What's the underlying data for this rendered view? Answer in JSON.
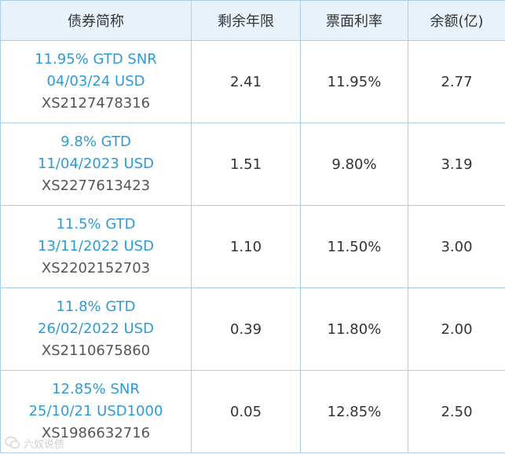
{
  "headers": [
    "债券简称",
    "剩余年限",
    "票面利率",
    "余额(亿)"
  ],
  "rows": [
    {
      "name_line1": "11.95% GTD SNR",
      "name_line2": "04/03/24 USD",
      "isin": "XS2127478316",
      "remaining_years": "2.41",
      "coupon_rate": "11.95%",
      "balance": "2.77"
    },
    {
      "name_line1": "9.8% GTD",
      "name_line2": "11/04/2023 USD",
      "isin": "XS2277613423",
      "remaining_years": "1.51",
      "coupon_rate": "9.80%",
      "balance": "3.19"
    },
    {
      "name_line1": "11.5% GTD",
      "name_line2": "13/11/2022 USD",
      "isin": "XS2202152703",
      "remaining_years": "1.10",
      "coupon_rate": "11.50%",
      "balance": "3.00"
    },
    {
      "name_line1": "11.8% GTD",
      "name_line2": "26/02/2022 USD",
      "isin": "XS2110675860",
      "remaining_years": "0.39",
      "coupon_rate": "11.80%",
      "balance": "2.00"
    },
    {
      "name_line1": "12.85% SNR",
      "name_line2": "25/10/21 USD1000",
      "isin": "XS1986632716",
      "remaining_years": "0.05",
      "coupon_rate": "12.85%",
      "balance": "2.50"
    }
  ],
  "watermark": {
    "text": "六奴说债",
    "icon": "wechat-like-icon"
  },
  "colors": {
    "header_bg": "#e8f2fb",
    "border": "#a8d0ee",
    "bond_name": "#2e9bd6",
    "text": "#333333"
  }
}
